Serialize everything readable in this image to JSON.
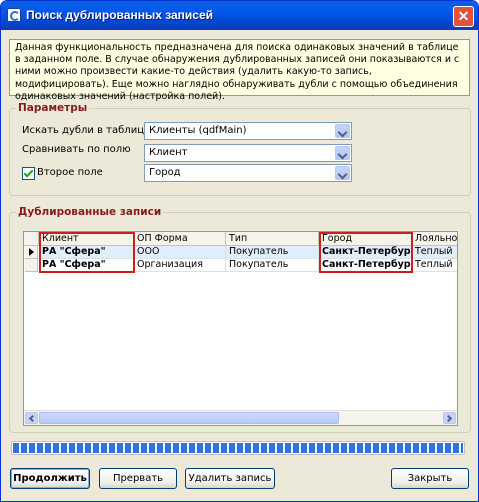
{
  "window": {
    "title": "Поиск дублированных записей",
    "close_glyph": "✕"
  },
  "info_text": "Данная функциональность предназначена для поиска одинаковых значений в таблице в заданном поле. В случае обнаружения дублированных записей они показываются и с ними можно произвести какие-то действия (удалить какую-то запись, модифицировать). Еще можно наглядно обнаруживать дубли с помощью объединения одинаковых значений (настройка полей).",
  "params": {
    "title": "Параметры",
    "table_label": "Искать дубли в таблице",
    "table_value": "Клиенты (qdfMain)",
    "field_label": "Сравнивать по полю",
    "field_value": "Клиент",
    "second_checked": true,
    "second_label": "Второе поле",
    "second_value": "Город"
  },
  "duplicates": {
    "title": "Дублированные записи",
    "columns": [
      "Клиент",
      "ОП Форма",
      "Тип",
      "Город",
      "Лояльно"
    ],
    "rows": [
      [
        "РА \"Сфера\"",
        "ООО",
        "Покупатель",
        "Санкт-Петербург",
        "Теплый"
      ],
      [
        "РА \"Сфера\"",
        "Организация",
        "Покупатель",
        "Санкт-Петербург",
        "Теплый"
      ]
    ]
  },
  "progress": {
    "fraction": 1.0
  },
  "buttons": {
    "continue": "Продолжить",
    "abort": "Прервать",
    "delete": "Удалить запись",
    "close": "Закрыть"
  },
  "colors": {
    "highlight": "#cc1f1f",
    "group_title": "#8a1a1a",
    "progress": "#2d72e0"
  }
}
